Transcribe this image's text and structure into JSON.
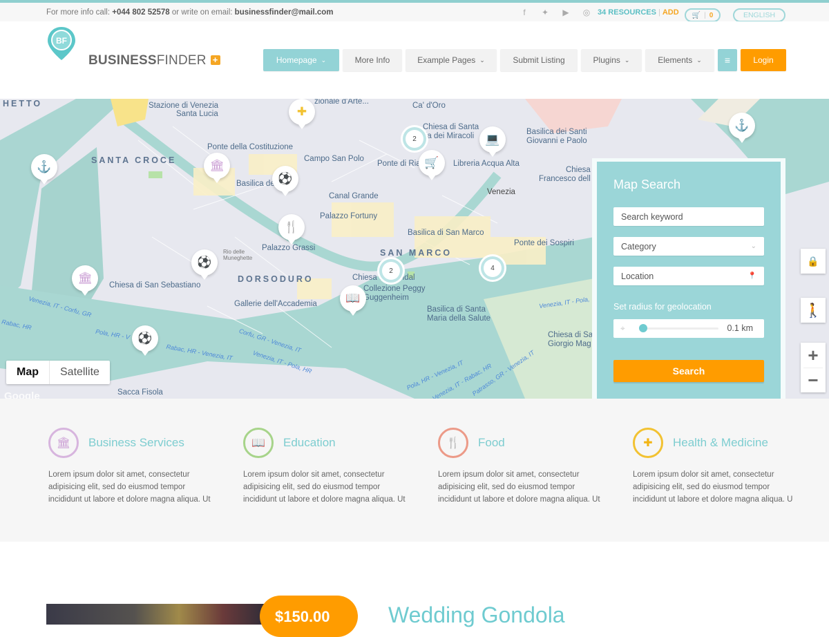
{
  "topbar": {
    "info_prefix": "For more info call:",
    "phone": "+044 802 52578",
    "info_middle": "or write on email:",
    "email": "businessfinder@mail.com",
    "social": [
      {
        "name": "facebook-icon",
        "glyph": "f"
      },
      {
        "name": "twitter-icon",
        "glyph": "🐦"
      },
      {
        "name": "youtube-icon",
        "glyph": "▶"
      },
      {
        "name": "dribbble-icon",
        "glyph": "◎"
      }
    ],
    "resources": "34 RESOURCES",
    "separator": "|",
    "add": "ADD",
    "cart_icon": "🛒",
    "cart_count": "0",
    "language": "ENGLISH"
  },
  "header": {
    "logo_bold": "BUSINESS",
    "logo_light": "FINDER",
    "logo_badge": "+",
    "logo_initials": "BF",
    "nav": [
      {
        "label": "Homepage",
        "dropdown": true,
        "active": true
      },
      {
        "label": "More Info",
        "dropdown": false
      },
      {
        "label": "Example Pages",
        "dropdown": true
      },
      {
        "label": "Submit Listing",
        "dropdown": false
      },
      {
        "label": "Plugins",
        "dropdown": true
      },
      {
        "label": "Elements",
        "dropdown": true
      }
    ],
    "menu_icon": "≡",
    "login": "Login"
  },
  "map": {
    "labels": {
      "ghetto": "HETTO",
      "stazione1": "Stazione di Venezia",
      "stazione2": "Santa Lucia",
      "galleria": "zionale d'Arte...",
      "cadoro": "Ca' d'Oro",
      "chiesa_santa1": "Chiesa di Santa",
      "chiesa_santa2": "ria dei Miracoli",
      "basilica_santi1": "Basilica dei Santi",
      "basilica_santi2": "Giovanni e Paolo",
      "ponte_cost": "Ponte della Costituzione",
      "santa_croce": "SANTA CROCE",
      "campo_sp": "Campo San Polo",
      "ponte_rialto": "Ponte di Ria",
      "libreria": "Libreria Acqua Alta",
      "chiesa_fr1": "Chiesa",
      "chiesa_fr2": "Francesco dell",
      "basilica_de": "Basilica de",
      "venezia": "Venezia",
      "canal_grande": "Canal Grande",
      "palazzo_fortuny": "Palazzo Fortuny",
      "basilica_sm": "Basilica di San Marco",
      "palazzo_grassi": "Palazzo Grassi",
      "ponte_sospiri": "Ponte dei Sospiri",
      "san_marco": "SAN MARCO",
      "dorsoduro": "DORSODURO",
      "chiesa_seb": "Chiesa di San Sebastiano",
      "chiesa_vidal": "Chiesa di S. Vidal",
      "peggy1": "Collezione Peggy",
      "peggy2": "Guggenheim",
      "gallerie": "Gallerie dell'Accademia",
      "salute1": "Basilica di Santa",
      "salute2": "Maria della Salute",
      "giorgio1": "Chiesa di Sa",
      "giorgio2": "Giorgio Mag",
      "sacca": "Sacca Fisola",
      "rio_mun1": "Rio delle",
      "rio_mun2": "Muneghette",
      "route1": "Venezia, IT - Corfu, GR",
      "route2": "Pola, HR - V",
      "route3": "Rabac, HR - Venezia, IT",
      "route4": "Corfu, GR - Venezia, IT",
      "route5": "Venezia, IT - Pola, HR",
      "route6": "Pola, HR - Venezia, IT",
      "route7": "Venezia, IT - Rabac, HR",
      "route8": "Patrasso, GR - Venezia, IT",
      "route9": "Rabac, HR",
      "route10": "Venezia, IT - Pola,"
    },
    "clusters": [
      "2",
      "2",
      "4"
    ],
    "map_type": {
      "map": "Map",
      "satellite": "Satellite"
    },
    "attribution": "Google",
    "controls": {
      "lock": "🔒",
      "pegman": "🚶",
      "zoom_in": "+",
      "zoom_out": "−"
    }
  },
  "search": {
    "title": "Map Search",
    "keyword_placeholder": "Search keyword",
    "category_placeholder": "Category",
    "location_placeholder": "Location",
    "radius_label": "Set radius for geolocation",
    "radius_value": "0.1 km",
    "radius_fraction": 0.02,
    "button": "Search"
  },
  "categories": [
    {
      "title": "Business Services",
      "icon": "🏛",
      "color": "#c99bd3",
      "desc": "Lorem ipsum dolor sit amet, consectetur adipisicing elit, sed do eiusmod tempor incididunt ut labore et dolore magna aliqua. Ut"
    },
    {
      "title": "Education",
      "icon": "📖",
      "color": "#8dc66a",
      "desc": "Lorem ipsum dolor sit amet, consectetur adipisicing elit, sed do eiusmod tempor incididunt ut labore et dolore magna aliqua. Ut"
    },
    {
      "title": "Food",
      "icon": "🍴",
      "color": "#e8806a",
      "desc": "Lorem ipsum dolor sit amet, consectetur adipisicing elit, sed do eiusmod tempor incididunt ut labore et dolore magna aliqua. Ut"
    },
    {
      "title": "Health & Medicine",
      "icon": "✚",
      "color": "#f2c232",
      "desc": "Lorem ipsum dolor sit amet, consectetur adipisicing elit, sed do eiusmod tempor incididunt ut labore et dolore magna aliqua. U"
    }
  ],
  "featured": {
    "price": "$150.00",
    "title": "Wedding Gondola"
  },
  "colors": {
    "accent": "#93d3d6",
    "orange": "#ff9c00",
    "title_teal": "#7dcdd0"
  }
}
